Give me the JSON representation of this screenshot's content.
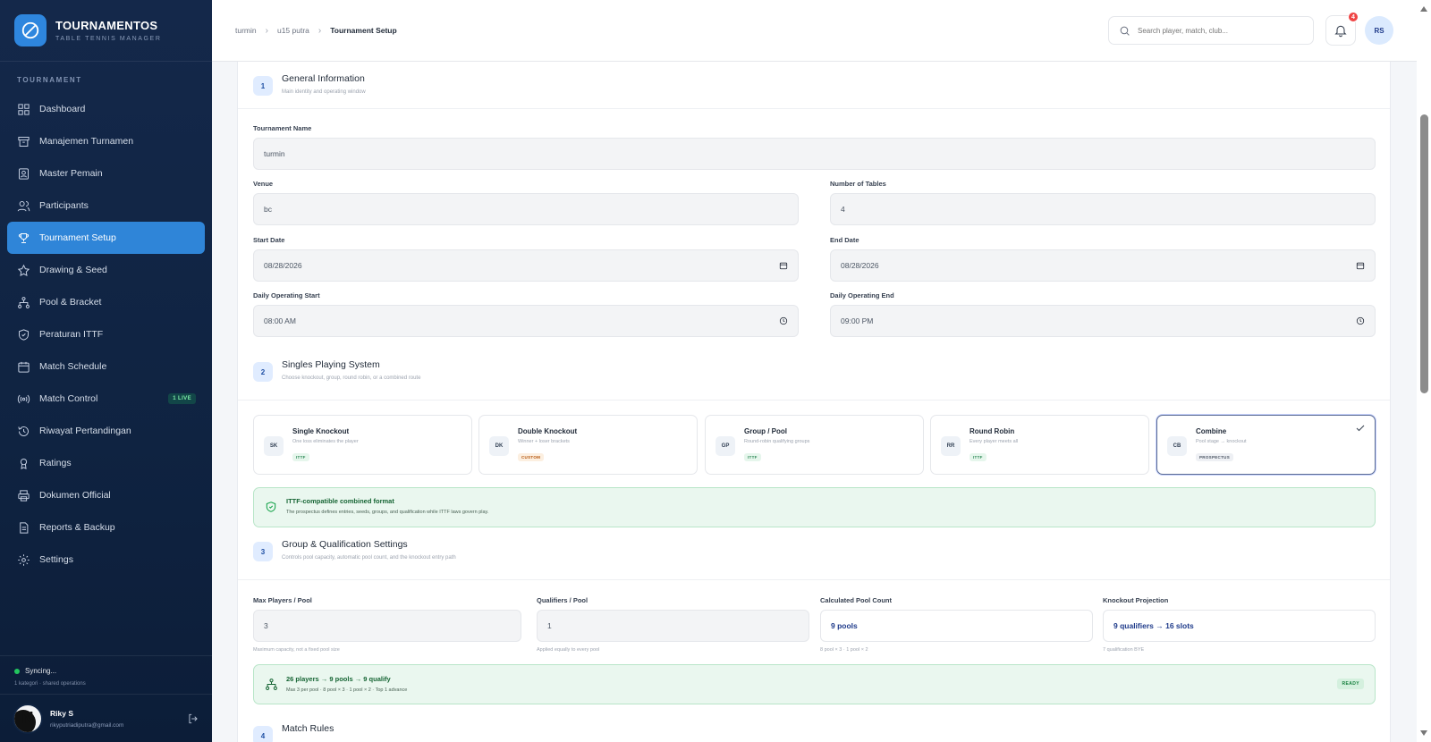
{
  "app": {
    "name": "TOURNAMENTOS",
    "subtitle": "TABLE TENNIS MANAGER"
  },
  "sidebar": {
    "section": "TOURNAMENT",
    "items": [
      {
        "label": "Dashboard",
        "icon": "grid-icon"
      },
      {
        "label": "Manajemen Turnamen",
        "icon": "archive-icon"
      },
      {
        "label": "Master Pemain",
        "icon": "player-id-icon"
      },
      {
        "label": "Participants",
        "icon": "users-icon"
      },
      {
        "label": "Tournament Setup",
        "icon": "trophy-icon",
        "active": true
      },
      {
        "label": "Drawing & Seed",
        "icon": "star-icon"
      },
      {
        "label": "Pool & Bracket",
        "icon": "bracket-icon"
      },
      {
        "label": "Peraturan ITTF",
        "icon": "shield-icon"
      },
      {
        "label": "Match Schedule",
        "icon": "calendar-icon"
      },
      {
        "label": "Match Control",
        "icon": "broadcast-icon",
        "badge": "1 LIVE"
      },
      {
        "label": "Riwayat Pertandingan",
        "icon": "history-icon"
      },
      {
        "label": "Ratings",
        "icon": "medal-icon"
      },
      {
        "label": "Dokumen Official",
        "icon": "printer-icon"
      },
      {
        "label": "Reports & Backup",
        "icon": "report-icon"
      },
      {
        "label": "Settings",
        "icon": "gear-icon"
      }
    ],
    "sync": {
      "status": "Syncing...",
      "sub": "1 kategori · shared operations"
    },
    "user": {
      "initial": "N",
      "name": "Riky S",
      "email": "rikyputriadiputra@gmail.com"
    }
  },
  "header": {
    "breadcrumb": [
      "turmin",
      "u15 putra",
      "Tournament Setup"
    ],
    "search_placeholder": "Search player, match, club...",
    "notifications": "4",
    "avatar": "RS"
  },
  "general": {
    "num": "1",
    "title": "General Information",
    "subtitle": "Main identity and operating window",
    "tournament_name_label": "Tournament Name",
    "tournament_name": "turmin",
    "venue_label": "Venue",
    "venue": "bc",
    "tables_label": "Number of Tables",
    "tables": "4",
    "start_date_label": "Start Date",
    "start_date": "08/28/2026",
    "end_date_label": "End Date",
    "end_date": "08/28/2026",
    "op_start_label": "Daily Operating Start",
    "op_start": "08:00 AM",
    "op_end_label": "Daily Operating End",
    "op_end": "09:00 PM"
  },
  "singles": {
    "num": "2",
    "title": "Singles Playing System",
    "subtitle": "Choose knockout, group, round robin, or a combined route",
    "options": [
      {
        "code": "SK",
        "title": "Single Knockout",
        "desc": "One loss eliminates the player",
        "tag": "ITTF"
      },
      {
        "code": "DK",
        "title": "Double Knockout",
        "desc": "Winner + loser brackets",
        "tag": "CUSTOM"
      },
      {
        "code": "GP",
        "title": "Group / Pool",
        "desc": "Round-robin qualifying groups",
        "tag": "ITTF"
      },
      {
        "code": "RR",
        "title": "Round Robin",
        "desc": "Every player meets all",
        "tag": "ITTF"
      },
      {
        "code": "CB",
        "title": "Combine",
        "desc": "Pool stage → knockout",
        "tag": "PROSPECTUS",
        "selected": true
      }
    ],
    "note_title": "ITTF-compatible combined format",
    "note_sub": "The prospectus defines entries, seeds, groups, and qualification while ITTF laws govern play."
  },
  "group": {
    "num": "3",
    "title": "Group & Qualification Settings",
    "subtitle": "Controls pool capacity, automatic pool count, and the knockout entry path",
    "max_label": "Max Players / Pool",
    "max_value": "3",
    "max_hint": "Maximum capacity, not a fixed pool size",
    "qual_label": "Qualifiers / Pool",
    "qual_value": "1",
    "qual_hint": "Applied equally to every pool",
    "pool_label": "Calculated Pool Count",
    "pool_value": "9 pools",
    "pool_hint": "8 pool × 3 · 1 pool × 2",
    "ko_label": "Knockout Projection",
    "ko_value": "9 qualifiers → 16 slots",
    "ko_hint": "7 qualification BYE",
    "summary_title": "26 players → 9 pools → 9 qualify",
    "summary_sub": "Max 3 per pool · 8 pool × 3 · 1 pool × 2 · Top 1 advance",
    "summary_badge": "READY"
  },
  "rules": {
    "num": "4",
    "title": "Match Rules"
  }
}
